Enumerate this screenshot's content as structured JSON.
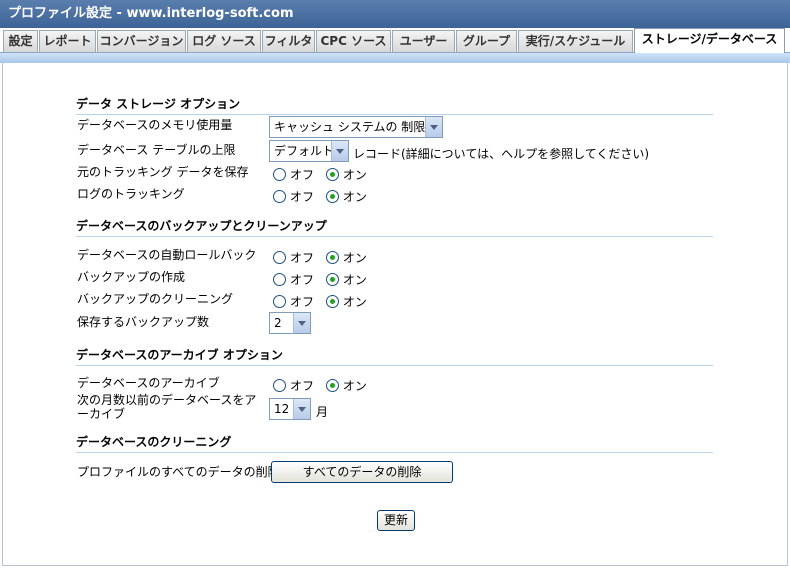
{
  "window": {
    "title": "プロファイル設定 - www.interlog-soft.com"
  },
  "tabs": [
    {
      "label": "設定"
    },
    {
      "label": "レポート"
    },
    {
      "label": "コンバージョン"
    },
    {
      "label": "ログ ソース"
    },
    {
      "label": "フィルタ"
    },
    {
      "label": "CPC ソース"
    },
    {
      "label": "ユーザー"
    },
    {
      "label": "グループ"
    },
    {
      "label": "実行/スケジュール"
    },
    {
      "label": "ストレージ/データベース",
      "active": true
    }
  ],
  "storage_options": {
    "heading": "データ ストレージ オプション",
    "memory_label": "データベースのメモリ使用量",
    "memory_value": "キャッシュ システムの 制限",
    "table_limit_label": "データベース テーブルの上限",
    "table_limit_value": "デフォルト",
    "table_limit_note": "レコード(詳細については、ヘルプを参照してください)",
    "keep_tracking_label": "元のトラッキング データを保存",
    "log_tracking_label": "ログのトラッキング"
  },
  "backup": {
    "heading": "データベースのバックアップとクリーンアップ",
    "auto_rollback_label": "データベースの自動ロールバック",
    "create_backup_label": "バックアップの作成",
    "cleanup_label": "バックアップのクリーニング",
    "keep_count_label": "保存するバックアップ数",
    "keep_count_value": "2"
  },
  "archive": {
    "heading": "データベースのアーカイブ オプション",
    "archive_label": "データベースのアーカイブ",
    "months_label": "次の月数以前のデータベースをアーカイブ",
    "months_value": "12",
    "months_unit": "月"
  },
  "cleaning": {
    "heading": "データベースのクリーニング",
    "delete_label": "プロファイルのすべてのデータの削除",
    "delete_button": "すべてのデータの削除"
  },
  "radio": {
    "off": "オフ",
    "on": "オン"
  },
  "selected": {
    "keep_tracking": "on",
    "log_tracking": "on",
    "auto_rollback": "on",
    "create_backup": "on",
    "cleanup": "on",
    "archive": "on"
  },
  "update_button": "更新"
}
